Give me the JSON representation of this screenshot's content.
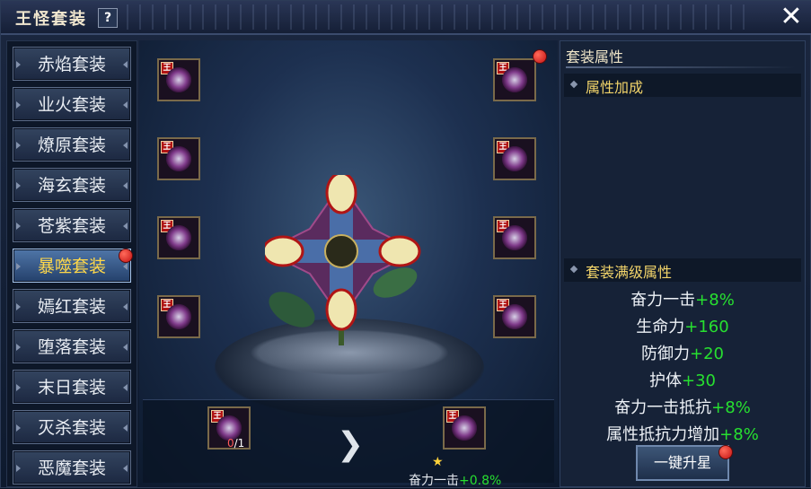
{
  "window": {
    "title": "王怪套装",
    "help": "?",
    "close": "✕"
  },
  "sets": [
    {
      "label": "赤焰套装",
      "active": false
    },
    {
      "label": "业火套装",
      "active": false
    },
    {
      "label": "燎原套装",
      "active": false
    },
    {
      "label": "海玄套装",
      "active": false
    },
    {
      "label": "苍紫套装",
      "active": false
    },
    {
      "label": "暴噬套装",
      "active": true
    },
    {
      "label": "嫣红套装",
      "active": false
    },
    {
      "label": "堕落套装",
      "active": false
    },
    {
      "label": "末日套装",
      "active": false
    },
    {
      "label": "灭杀套装",
      "active": false
    },
    {
      "label": "恶魔套装",
      "active": false
    }
  ],
  "slot_badge": "王",
  "upgrade": {
    "count_have": "0",
    "count_sep": "/1",
    "bonus_name": "奋力一击",
    "bonus_value": "+0.8%"
  },
  "right_panel": {
    "title": "套装属性",
    "section_bonus": "属性加成",
    "section_full": "套装满级属性",
    "attrs": [
      {
        "name": "奋力一击",
        "value": "+8%"
      },
      {
        "name": "生命力",
        "value": "+160"
      },
      {
        "name": "防御力",
        "value": "+20"
      },
      {
        "name": "护体",
        "value": "+30"
      },
      {
        "name": "奋力一击抵抗",
        "value": "+8%"
      },
      {
        "name": "属性抵抗力增加",
        "value": "+8%"
      }
    ],
    "button": "一键升星"
  },
  "colors": {
    "accent_green": "#27e030",
    "active_tab_text": "#ffd84a",
    "red_dot": "#c31212"
  }
}
